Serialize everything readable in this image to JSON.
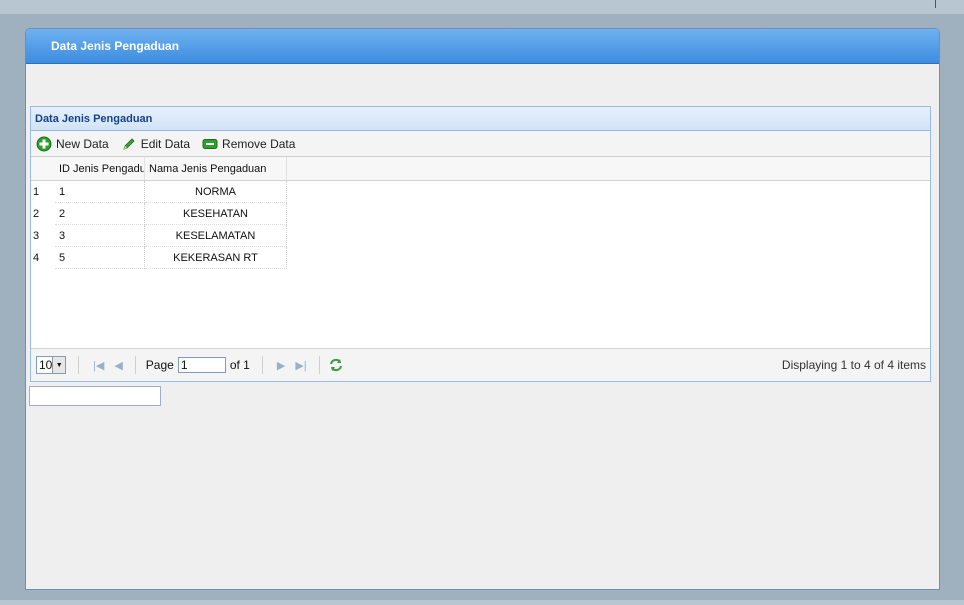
{
  "window": {
    "title": "Data Jenis Pengaduan"
  },
  "panel": {
    "title": "Data Jenis Pengaduan"
  },
  "toolbar": {
    "new_label": "New Data",
    "edit_label": "Edit Data",
    "remove_label": "Remove Data"
  },
  "grid": {
    "columns": [
      "ID Jenis Pengaduan",
      "Nama Jenis Pengaduan"
    ],
    "rows": [
      {
        "num": "1",
        "id": "1",
        "name": "NORMA"
      },
      {
        "num": "2",
        "id": "2",
        "name": "KESEHATAN"
      },
      {
        "num": "3",
        "id": "3",
        "name": "KESELAMATAN"
      },
      {
        "num": "4",
        "id": "5",
        "name": "KEKERASAN RT"
      }
    ]
  },
  "pager": {
    "page_size": "10",
    "page_label": "Page",
    "page_value": "1",
    "of_label": "of 1",
    "display_info": "Displaying 1 to 4 of 4 items"
  },
  "colors": {
    "header_blue": "#3d8de0",
    "panel_title": "#15428b",
    "add_icon": "#2e9e2e",
    "edit_icon": "#3aa63a",
    "refresh_icon": "#3c9a3c"
  }
}
